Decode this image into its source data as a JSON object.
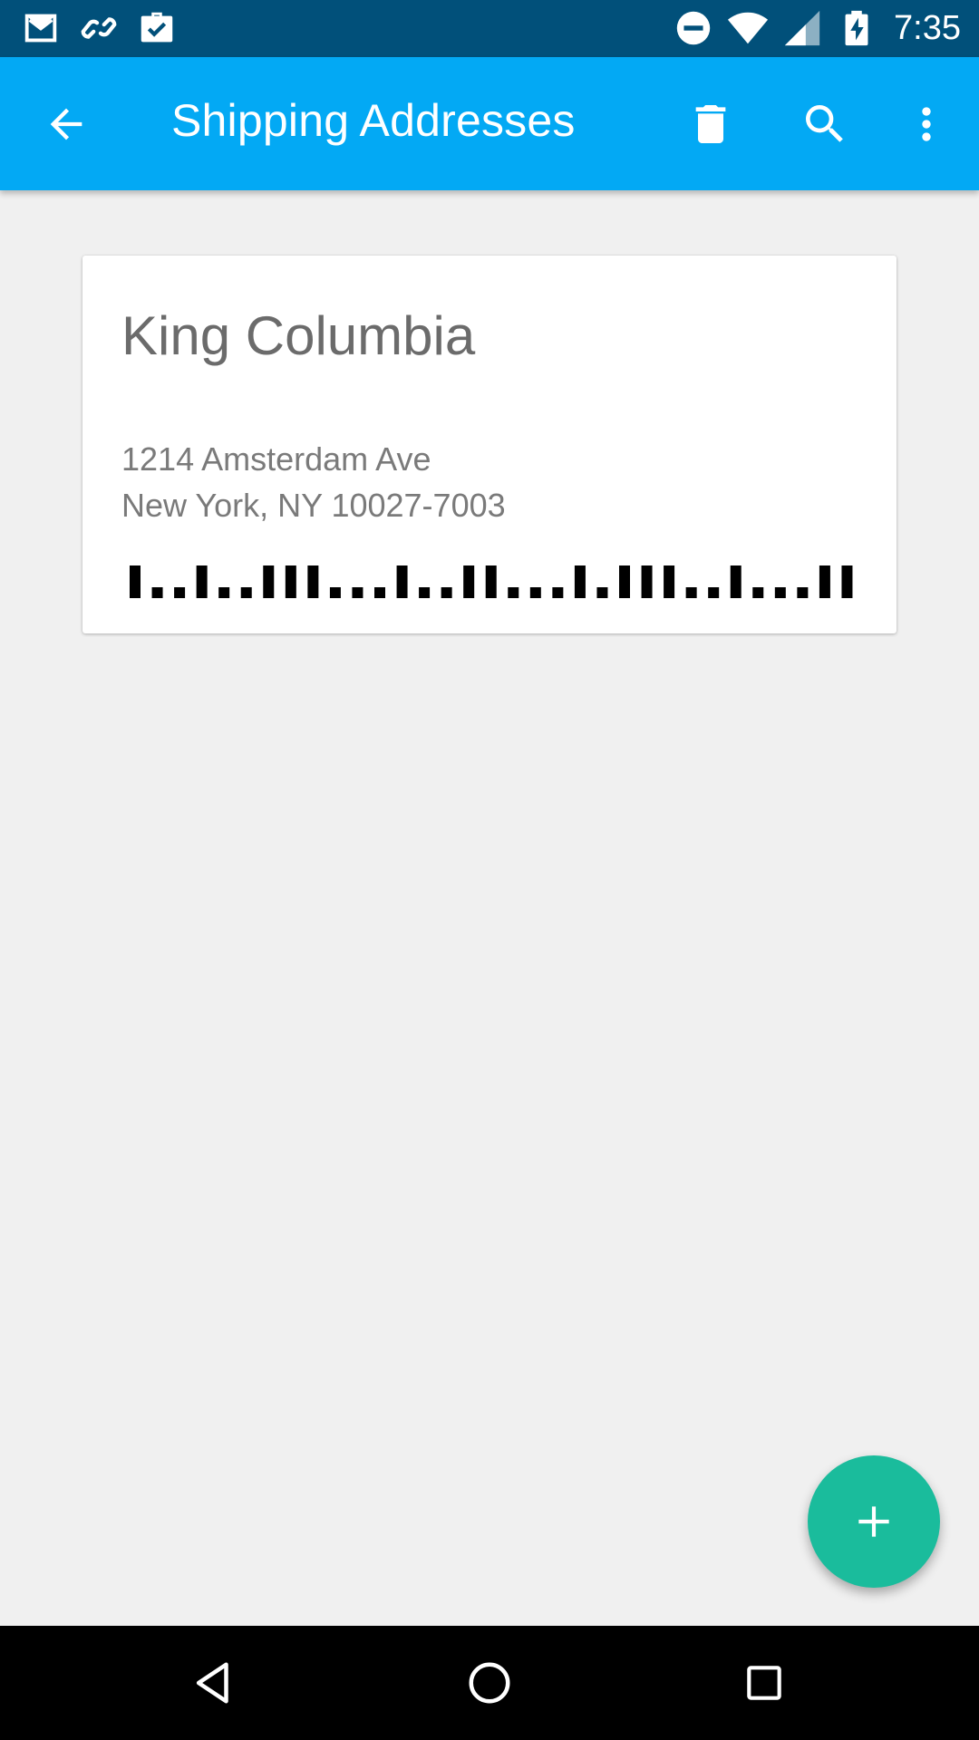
{
  "status_bar": {
    "time": "7:35",
    "left_icons": [
      "gmail-icon",
      "link-icon",
      "briefcase-check-icon"
    ],
    "right_icons": [
      "do-not-disturb-icon",
      "wifi-icon",
      "cellular-signal-icon",
      "battery-charging-icon"
    ]
  },
  "app_bar": {
    "title": "Shipping Addresses",
    "actions": [
      "back-arrow-icon",
      "delete-icon",
      "search-icon",
      "more-vert-icon"
    ],
    "background": "#03a9f4"
  },
  "addresses": [
    {
      "name": "King Columbia",
      "line1": "1214 Amsterdam Ave",
      "line2": "New York, NY 10027-7003",
      "barcode_bars": [
        1,
        0,
        0,
        1,
        0,
        0,
        1,
        1,
        1,
        0,
        0,
        0,
        1,
        0,
        0,
        1,
        1,
        0,
        0,
        0,
        1,
        0,
        1,
        1,
        1,
        0,
        0,
        1,
        0,
        0,
        0,
        1,
        1
      ]
    }
  ],
  "fab": {
    "icon": "plus-icon",
    "color": "#1abc9c"
  },
  "nav_bar": {
    "buttons": [
      "back-nav-icon",
      "home-nav-icon",
      "recents-nav-icon"
    ]
  },
  "colors": {
    "status_bar": "#01507a",
    "background": "#f0f0f0"
  }
}
